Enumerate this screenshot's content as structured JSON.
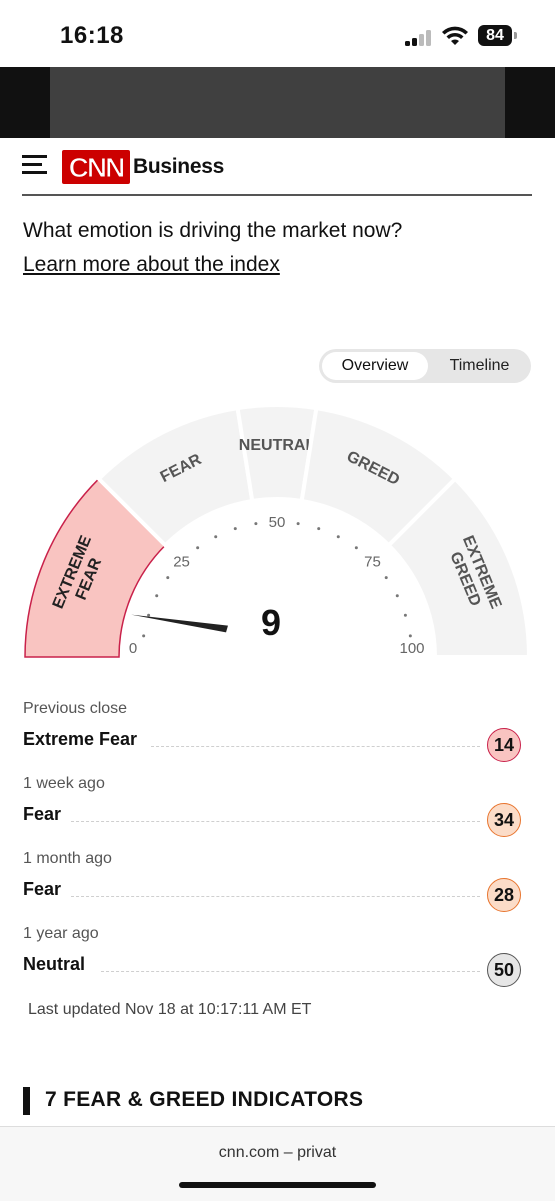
{
  "status_bar": {
    "time": "16:18",
    "battery": "84"
  },
  "header": {
    "logo": "CNN",
    "section": "Business"
  },
  "intro": {
    "question": "What emotion is driving the market now?",
    "learn_more": "Learn more about the index"
  },
  "toggle": {
    "overview": "Overview",
    "timeline": "Timeline",
    "selected": "Overview"
  },
  "gauge": {
    "value": 9,
    "current_zone": "Extreme Fear",
    "zones": [
      "EXTREME FEAR",
      "FEAR",
      "NEUTRAL",
      "GREED",
      "EXTREME GREED"
    ],
    "ticks": [
      "0",
      "25",
      "50",
      "75",
      "100"
    ],
    "colors": {
      "active_zone": "#f9c4c1",
      "active_border": "#c9214a",
      "inactive_zone": "#f3f3f3",
      "needle": "#222222"
    }
  },
  "history": [
    {
      "label": "Previous close",
      "rating": "Extreme Fear",
      "score": "14",
      "color": "#f9c4c1",
      "border": "#c9214a"
    },
    {
      "label": "1 week ago",
      "rating": "Fear",
      "score": "34",
      "color": "#fbdcc8",
      "border": "#e8752f"
    },
    {
      "label": "1 month ago",
      "rating": "Fear",
      "score": "28",
      "color": "#fbdcc8",
      "border": "#e8752f"
    },
    {
      "label": "1 year ago",
      "rating": "Neutral",
      "score": "50",
      "color": "#e6e6e6",
      "border": "#555555"
    }
  ],
  "last_updated": "Last updated Nov 18 at 10:17:11 AM ET",
  "indicators": {
    "title": "7 FEAR & GREED INDICATORS"
  },
  "browser": {
    "url": "cnn.com",
    "mode": "privat"
  }
}
